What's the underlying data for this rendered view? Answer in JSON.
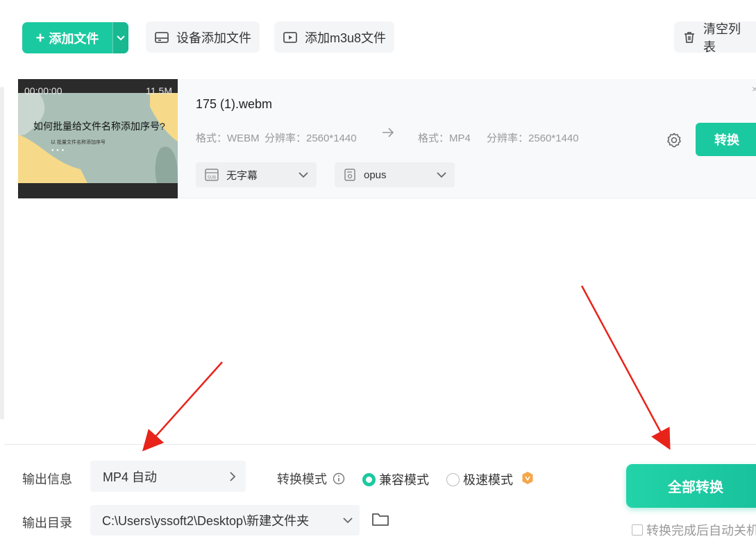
{
  "toolbar": {
    "add_file": "添加文件",
    "add_device_file": "设备添加文件",
    "add_m3u8": "添加m3u8文件",
    "clear_list": "清空列表"
  },
  "file": {
    "thumbnail": {
      "time": "00:00:00",
      "size": "11.5M",
      "title_text": "如何批量给文件名称添加序号?",
      "subtitle_text": "以 批量文件名称添加序号",
      "dots": "● ● ●"
    },
    "name": "175 (1).webm",
    "source": {
      "format": "格式：WEBM",
      "resolution": "分辨率：2560*1440"
    },
    "target": {
      "format": "格式：MP4",
      "resolution": "分辨率：2560*1440"
    },
    "subtitle_select": "无字幕",
    "audio_select": "opus",
    "convert_label": "转换",
    "close": "×"
  },
  "output": {
    "info_label": "输出信息",
    "info_value": "MP4 自动",
    "dir_label": "输出目录",
    "dir_value": "C:\\Users\\yssoft2\\Desktop\\新建文件夹"
  },
  "mode": {
    "label": "转换模式",
    "options": [
      {
        "label": "兼容模式",
        "selected": true
      },
      {
        "label": "极速模式",
        "selected": false
      }
    ]
  },
  "convert_all_label": "全部转换",
  "auto_shutdown_label": "转换完成后自动关机",
  "colors": {
    "accent": "#1bc9a0",
    "annotation_arrow": "#e8231a",
    "vip_badge": "#f5a64a"
  }
}
